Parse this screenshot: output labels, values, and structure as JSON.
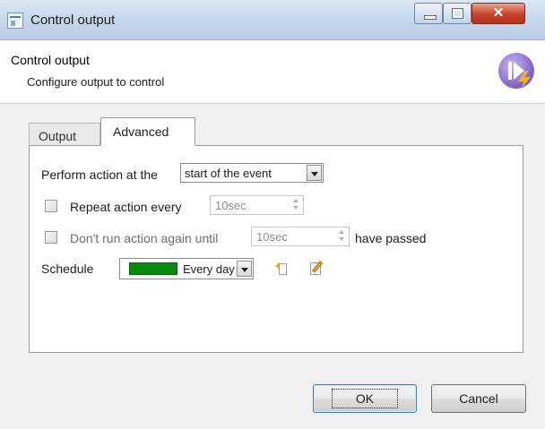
{
  "window": {
    "title": "Control output",
    "icon": "dialog-window-icon",
    "controls": [
      "minimize-icon",
      "maximize-icon",
      "close-icon"
    ]
  },
  "header": {
    "title": "Control output",
    "subtitle": "Configure output to control",
    "icon": "play-lightning-icon"
  },
  "tabs": [
    {
      "label": "Output",
      "active": false
    },
    {
      "label": "Advanced",
      "active": true
    }
  ],
  "advanced": {
    "perform_action_label": "Perform action at the",
    "perform_action_value": "start of the event",
    "repeat_action": {
      "label": "Repeat action every",
      "checked": false,
      "value": "10sec",
      "enabled": false
    },
    "dont_run": {
      "label": "Don't run action again until",
      "checked": false,
      "value": "10sec",
      "suffix": "have passed",
      "enabled": false
    },
    "schedule": {
      "label": "Schedule",
      "value": "Every day",
      "color": "#078a0e",
      "new_icon": "new-schedule-icon",
      "edit_icon": "edit-schedule-icon"
    }
  },
  "buttons": {
    "ok": "OK",
    "cancel": "Cancel"
  }
}
